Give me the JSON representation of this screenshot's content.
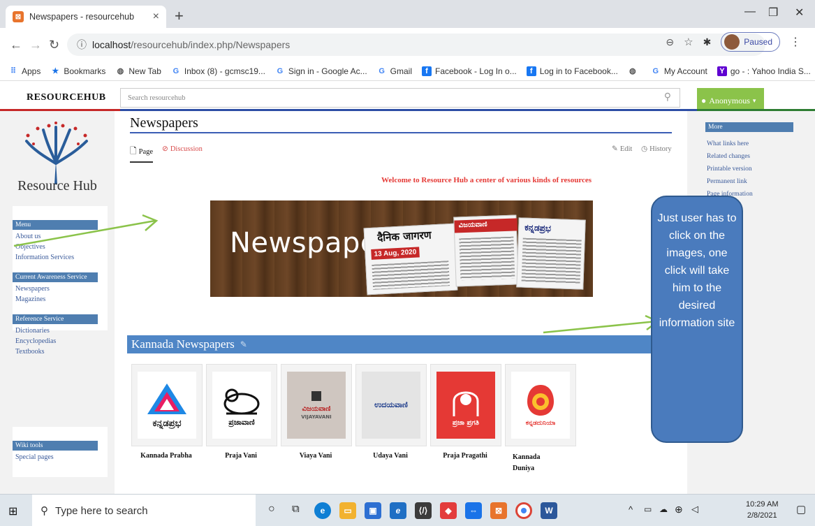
{
  "browser": {
    "tab_title": "Newspapers - resourcehub",
    "tab_favicon": "xampp-icon",
    "url_host": "localhost",
    "url_path": "/resourcehub/index.php/Newspapers",
    "profile_status": "Paused",
    "bookmarks": [
      {
        "label": "Apps",
        "icon": "apps-grid-icon",
        "color": "#4285f4"
      },
      {
        "label": "Bookmarks",
        "icon": "star-icon",
        "color": "#1a73e8"
      },
      {
        "label": "New Tab",
        "icon": "globe-icon",
        "color": "#555555"
      },
      {
        "label": "Inbox (8) - gcmsc19...",
        "icon": "google-icon",
        "color": "#4285f4"
      },
      {
        "label": "Sign in - Google Ac...",
        "icon": "google-icon",
        "color": "#4285f4"
      },
      {
        "label": "Gmail",
        "icon": "google-icon",
        "color": "#4285f4"
      },
      {
        "label": "Facebook - Log In o...",
        "icon": "facebook-icon",
        "color": "#1877f2"
      },
      {
        "label": "Log in to Facebook...",
        "icon": "facebook-icon",
        "color": "#1877f2"
      },
      {
        "label": "",
        "icon": "globe-icon",
        "color": "#555555"
      },
      {
        "label": "My Account",
        "icon": "google-icon",
        "color": "#4285f4"
      },
      {
        "label": "go - : Yahoo India S...",
        "icon": "yahoo-icon",
        "color": "#5f01d1"
      }
    ],
    "bookmarks_overflow": "»"
  },
  "wiki": {
    "brand": "RESOURCEHUB",
    "search_placeholder": "Search resourcehub",
    "user_menu": "Anonymous",
    "logo_text": "Resource Hub",
    "sidebar": {
      "sections": [
        {
          "header": "Menu",
          "items": [
            "About us",
            "Objectives",
            "Information Services"
          ]
        },
        {
          "header": "Current Awareness Service",
          "items": [
            "Newspapers",
            "Magazines"
          ]
        },
        {
          "header": "Reference Service",
          "items": [
            "Dictionaries",
            "Encyclopedias",
            "Textbooks"
          ]
        }
      ],
      "tools": {
        "header": "Wiki tools",
        "items": [
          "Special pages"
        ]
      }
    },
    "page_title": "Newspapers",
    "tabs": {
      "page": "Page",
      "discussion": "Discussion",
      "edit": "Edit",
      "history": "History"
    },
    "welcome": "Welcome to Resource Hub a center of various kinds of resources",
    "banner": {
      "title": "Newspapers",
      "date_tag": "13 Aug, 2020",
      "headline_1": "दैनिक जागरण",
      "headline_2": "ವಿಜಯವಾಣಿ",
      "headline_3": "ಕನ್ನಡಪ್ರಭ"
    },
    "section_title": "Kannada Newspapers",
    "newspapers": [
      {
        "name": "Kannada Prabha",
        "logo_text": "ಕನ್ನಡಪ್ರಭ",
        "bg": "#ffffff",
        "fg": "#1a1a1a"
      },
      {
        "name": "Praja Vani",
        "logo_text": "ಪ್ರಜಾವಾಣಿ",
        "bg": "#ffffff",
        "fg": "#1a1a1a"
      },
      {
        "name": "Viaya Vani",
        "logo_text": "ವಿಜಯವಾಣಿ",
        "logo_sub": "VIJAYAVANI",
        "bg": "#cfc6c0",
        "fg": "#b71c1c"
      },
      {
        "name": "Udaya Vani",
        "logo_text": "ಉದಯವಾಣಿ",
        "bg": "#e4e4e4",
        "fg": "#1b3a8a"
      },
      {
        "name": "Praja Pragathi",
        "logo_text": "ಪ್ರಜಾ ಪ್ರಗತಿ",
        "bg": "#e53935",
        "fg": "#ffffff"
      },
      {
        "name": "Kannada Duniya",
        "logo_text": "ಕನ್ನಡದುನಿಯಾ",
        "bg": "#ffffff",
        "fg": "#e53935"
      }
    ],
    "more": {
      "header": "More",
      "items": [
        "What links here",
        "Related changes",
        "Printable version",
        "Permanent link",
        "Page information"
      ]
    }
  },
  "annotation": {
    "callout_text": "Just user has to click on the images, one click will take him to the desired information site"
  },
  "taskbar": {
    "search_placeholder": "Type here to search",
    "time": "10:29 AM",
    "date": "2/8/2021"
  },
  "colors": {
    "sidebar_header": "#4f7eb0",
    "section_header": "#4f86c6",
    "user_menu": "#8bc34a",
    "welcome_text": "#e53935",
    "arrow": "#8bc34a"
  }
}
